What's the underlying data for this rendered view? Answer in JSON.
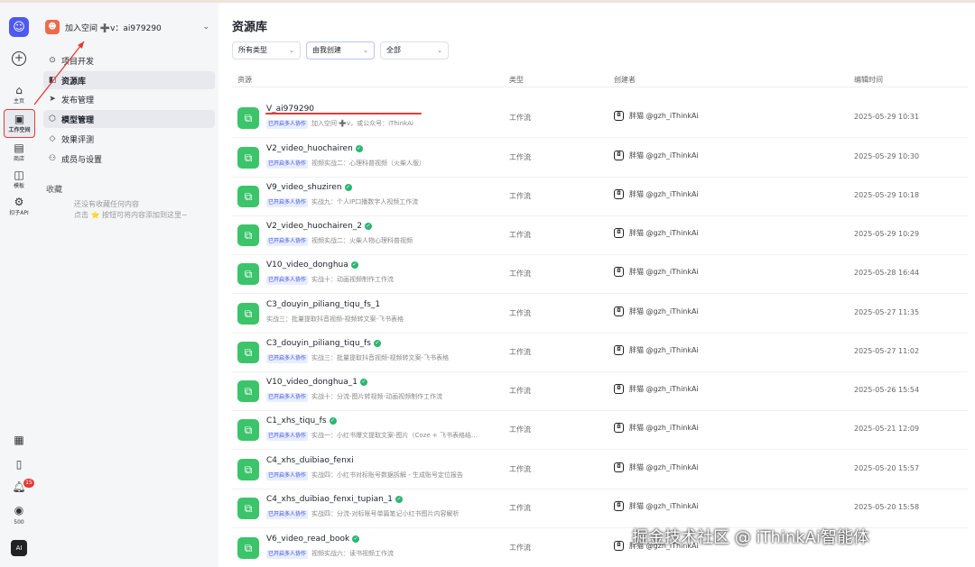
{
  "rail": {
    "home": "主页",
    "workspace": "工作空间",
    "store": "商店",
    "templates": "模板",
    "api": "扣子API",
    "badge_count": "15",
    "credits": "500",
    "avatar": "AI"
  },
  "panel": {
    "space_name": "加入空间 ➕v：ai979290",
    "nav": [
      "项目开发",
      "资源库",
      "发布管理",
      "模型管理",
      "效果评测",
      "成员与设置"
    ],
    "favorites_title": "收藏",
    "favorites_empty_1": "还没有收藏任何内容",
    "favorites_empty_2": "点击 ⭐ 按钮可将内容添加到这里~"
  },
  "main": {
    "title": "资源库",
    "filter_type": "所有类型",
    "filter_creator": "由我创建",
    "filter_all": "全部",
    "col_resource": "资源",
    "col_type": "类型",
    "col_creator": "创建者",
    "col_edit_time": "编辑时间"
  },
  "rows": [
    {
      "name": "V_ai979290",
      "ok": false,
      "tag": "已开启多人协作",
      "desc": "加入空间 ➕v，或公众号：iThinkAi",
      "type": "工作流",
      "creator": "胖猫 @gzh_iThinkAi",
      "time": "2025-05-29 10:31"
    },
    {
      "name": "V2_video_huochairen",
      "ok": true,
      "tag": "已开启多人协作",
      "desc": "视频实战二：心理科普视频（火柴人版）",
      "type": "工作流",
      "creator": "胖猫 @gzh_iThinkAi",
      "time": "2025-05-29 10:30"
    },
    {
      "name": "V9_video_shuziren",
      "ok": true,
      "tag": "已开启多人协作",
      "desc": "实战九：个人IP口播数字人视频工作流",
      "type": "工作流",
      "creator": "胖猫 @gzh_iThinkAi",
      "time": "2025-05-29 10:18"
    },
    {
      "name": "V2_video_huochairen_2",
      "ok": true,
      "tag": "已开启多人协作",
      "desc": "视频实战二：火柴人物心理科普视频",
      "type": "工作流",
      "creator": "胖猫 @gzh_iThinkAi",
      "time": "2025-05-29 10:29"
    },
    {
      "name": "V10_video_donghua",
      "ok": true,
      "tag": "已开启多人协作",
      "desc": "实战十：动画视频制作工作流",
      "type": "工作流",
      "creator": "胖猫 @gzh_iThinkAi",
      "time": "2025-05-28 16:44"
    },
    {
      "name": "C3_douyin_piliang_tiqu_fs_1",
      "ok": false,
      "tag": "",
      "desc": "实战三：批量提取抖音视频-视频转文案-飞书表格",
      "type": "工作流",
      "creator": "胖猫 @gzh_iThinkAi",
      "time": "2025-05-27 11:35"
    },
    {
      "name": "C3_douyin_piliang_tiqu_fs",
      "ok": true,
      "tag": "已开启多人协作",
      "desc": "实战三：批量提取抖音视频-视频转文案-飞书表格",
      "type": "工作流",
      "creator": "胖猫 @gzh_iThinkAi",
      "time": "2025-05-27 11:02"
    },
    {
      "name": "V10_video_donghua_1",
      "ok": true,
      "tag": "已开启多人协作",
      "desc": "实战十：分流-图片转视频-动画视频制作工作流",
      "type": "工作流",
      "creator": "胖猫 @gzh_iThinkAi",
      "time": "2025-05-26 15:54"
    },
    {
      "name": "C1_xhs_tiqu_fs",
      "ok": true,
      "tag": "已开启多人协作",
      "desc": "实战一：小红书爆文提取文案-图片（Coze + 飞书表格结…",
      "type": "工作流",
      "creator": "胖猫 @gzh_iThinkAi",
      "time": "2025-05-21 12:09"
    },
    {
      "name": "C4_xhs_duibiao_fenxi",
      "ok": false,
      "tag": "已开启多人协作",
      "desc": "实战四：小红书对标账号数据拆解 - 生成账号定位报告",
      "type": "工作流",
      "creator": "胖猫 @gzh_iThinkAi",
      "time": "2025-05-20 15:57"
    },
    {
      "name": "C4_xhs_duibiao_fenxi_tupian_1",
      "ok": true,
      "tag": "已开启多人协作",
      "desc": "实战四：分流-对标账号单篇笔记小红书图片内容解析",
      "type": "工作流",
      "creator": "胖猫 @gzh_iThinkAi",
      "time": "2025-05-20 15:58"
    },
    {
      "name": "V6_video_read_book",
      "ok": true,
      "tag": "已开启多人协作",
      "desc": "视频实战六：读书视频工作流",
      "type": "工作流",
      "creator": "胖猫 @gzh_iThinkAi",
      "time": ""
    }
  ],
  "watermark": "掘金技术社区 @ iThinkAi智能体"
}
